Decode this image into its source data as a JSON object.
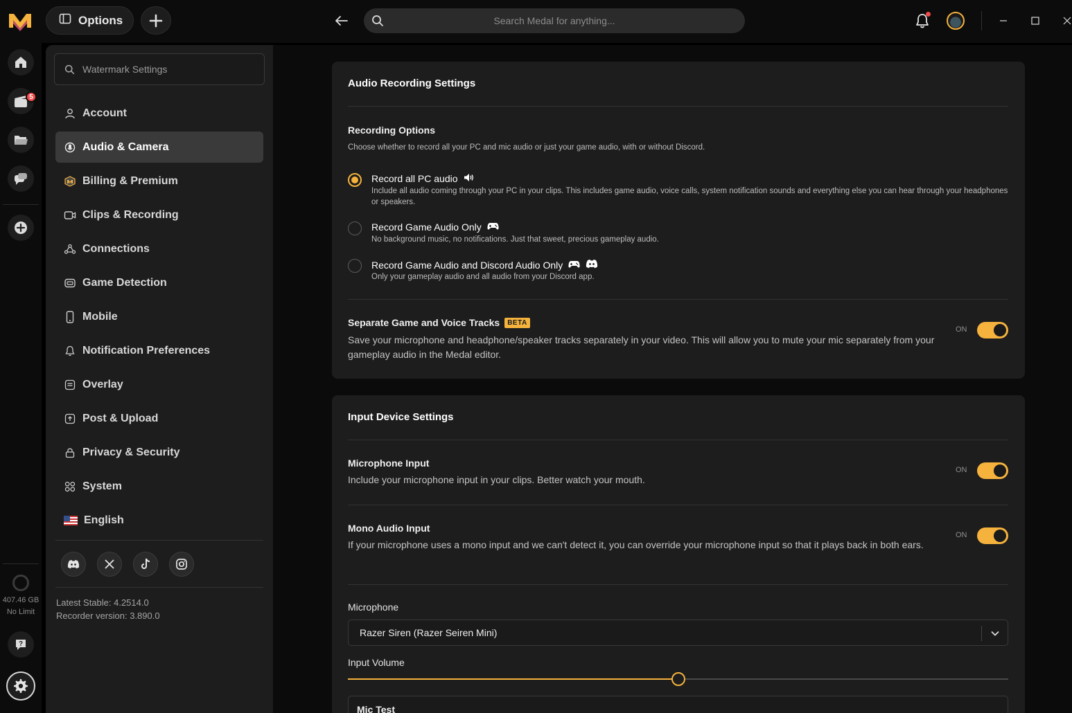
{
  "app": {
    "options_label": "Options",
    "search_placeholder": "Search Medal for anything..."
  },
  "rail": {
    "clips_badge": "5",
    "storage_size": "407.46 GB",
    "storage_limit": "No Limit"
  },
  "sidebar": {
    "search_placeholder": "Watermark Settings",
    "items": [
      {
        "label": "Account",
        "icon": "user-icon"
      },
      {
        "label": "Audio & Camera",
        "icon": "microphone-icon",
        "active": true
      },
      {
        "label": "Billing & Premium",
        "icon": "premium-icon"
      },
      {
        "label": "Clips & Recording",
        "icon": "camera-icon"
      },
      {
        "label": "Connections",
        "icon": "connections-icon"
      },
      {
        "label": "Game Detection",
        "icon": "gamepad-icon"
      },
      {
        "label": "Mobile",
        "icon": "mobile-icon"
      },
      {
        "label": "Notification Preferences",
        "icon": "bell-icon"
      },
      {
        "label": "Overlay",
        "icon": "overlay-icon"
      },
      {
        "label": "Post & Upload",
        "icon": "upload-icon"
      },
      {
        "label": "Privacy & Security",
        "icon": "lock-icon"
      },
      {
        "label": "System",
        "icon": "grid-icon"
      },
      {
        "label": "English",
        "icon": "us-flag-icon"
      }
    ],
    "socials": [
      "discord-icon",
      "x-icon",
      "tiktok-icon",
      "instagram-icon"
    ],
    "latest_stable": "Latest Stable: 4.2514.0",
    "recorder_version": "Recorder version: 3.890.0"
  },
  "audio_card": {
    "title": "Audio Recording Settings",
    "recording_options_title": "Recording Options",
    "recording_options_desc": "Choose whether to record all your PC and mic audio or just your game audio, with or without Discord.",
    "options": [
      {
        "label": "Record all PC audio",
        "desc": "Include all audio coming through your PC in your clips. This includes game audio, voice calls, system notification sounds and everything else you can hear through your headphones or speakers.",
        "selected": true
      },
      {
        "label": "Record Game Audio Only",
        "desc": "No background music, no notifications. Just that sweet, precious gameplay audio.",
        "selected": false
      },
      {
        "label": "Record Game Audio and Discord Audio Only",
        "desc": "Only your gameplay audio and all audio from your Discord app.",
        "selected": false
      }
    ],
    "separate_tracks_title": "Separate Game and Voice Tracks",
    "beta_badge": "BETA",
    "separate_tracks_desc": "Save your microphone and headphone/speaker tracks separately in your video. This will allow you to mute your mic separately from your gameplay audio in the Medal editor.",
    "separate_tracks_state": "ON"
  },
  "input_card": {
    "title": "Input Device Settings",
    "mic_input_title": "Microphone Input",
    "mic_input_desc": "Include your microphone input in your clips. Better watch your mouth.",
    "mic_input_state": "ON",
    "mono_title": "Mono Audio Input",
    "mono_desc": "If your microphone uses a mono input and we can't detect it, you can override your microphone input so that it plays back in both ears.",
    "mono_state": "ON",
    "microphone_label": "Microphone",
    "microphone_value": "Razer Siren (Razer Seiren Mini)",
    "input_volume_label": "Input Volume",
    "input_volume_fraction": 0.5,
    "mic_test_label": "Mic Test"
  },
  "colors": {
    "accent": "#f5b23d",
    "panel": "#1d1d1d",
    "background": "#0b0b0b",
    "badge": "#f24b4b"
  }
}
